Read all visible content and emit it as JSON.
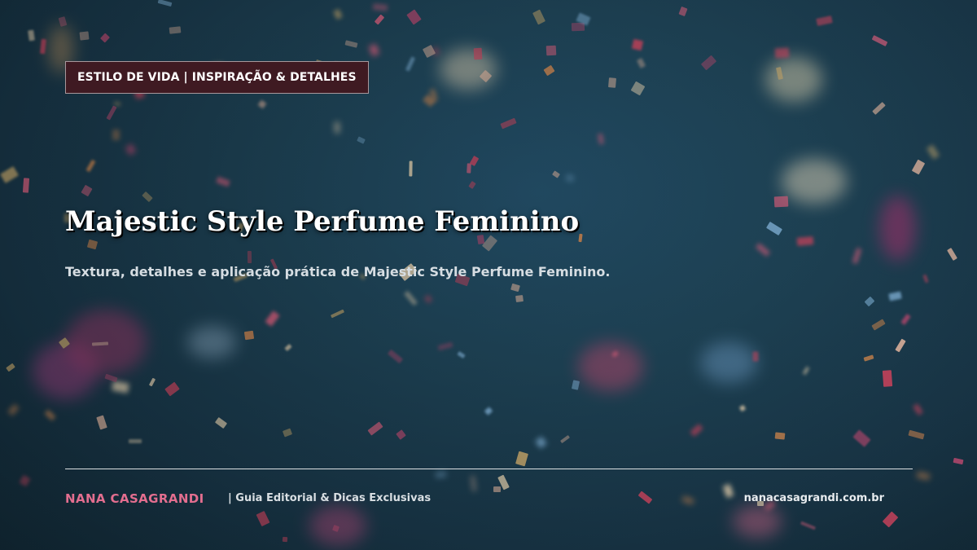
{
  "header": {
    "category": "ESTILO DE VIDA | INSPIRAÇÃO & DETALHES"
  },
  "main": {
    "title": "Majestic Style Perfume Feminino",
    "subtitle": "Textura, detalhes e aplicação prática de Majestic Style Perfume Feminino."
  },
  "footer": {
    "brand": "NANA CASAGRANDI",
    "tagline": "|  Guia Editorial & Dicas Exclusivas",
    "url": "nanacasagrandi.com.br"
  },
  "colors": {
    "background": "#1f4457",
    "badge_background": "#3f1a22",
    "brand_accent": "#e36e8f"
  }
}
